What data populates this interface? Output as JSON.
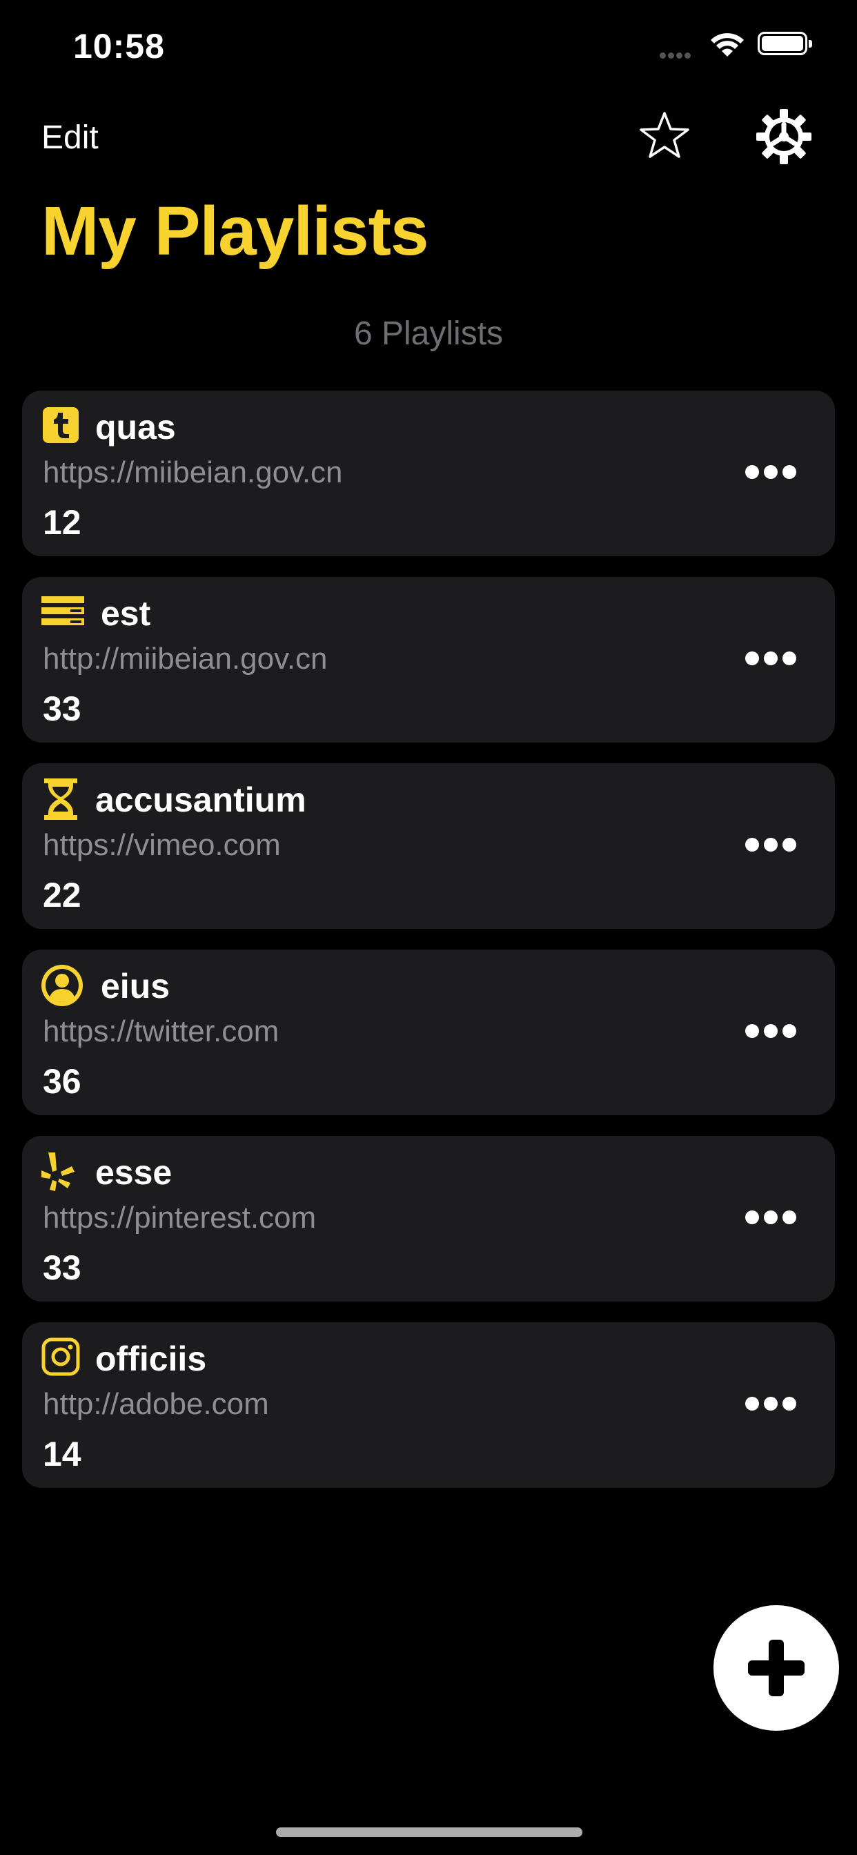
{
  "status": {
    "time": "10:58"
  },
  "nav": {
    "edit_label": "Edit"
  },
  "page": {
    "title": "My Playlists",
    "count_text": "6 Playlists"
  },
  "accent": "#F8D22E",
  "playlists": [
    {
      "icon": "tumblr-icon",
      "name": "quas",
      "url": "https://miibeian.gov.cn",
      "count": "12"
    },
    {
      "icon": "server-icon",
      "name": "est",
      "url": "http://miibeian.gov.cn",
      "count": "33"
    },
    {
      "icon": "hourglass-icon",
      "name": "accusantium",
      "url": "https://vimeo.com",
      "count": "22"
    },
    {
      "icon": "user-circle-icon",
      "name": "eius",
      "url": "https://twitter.com",
      "count": "36"
    },
    {
      "icon": "yelp-icon",
      "name": "esse",
      "url": "https://pinterest.com",
      "count": "33"
    },
    {
      "icon": "instagram-icon",
      "name": "officiis",
      "url": "http://adobe.com",
      "count": "14"
    }
  ]
}
